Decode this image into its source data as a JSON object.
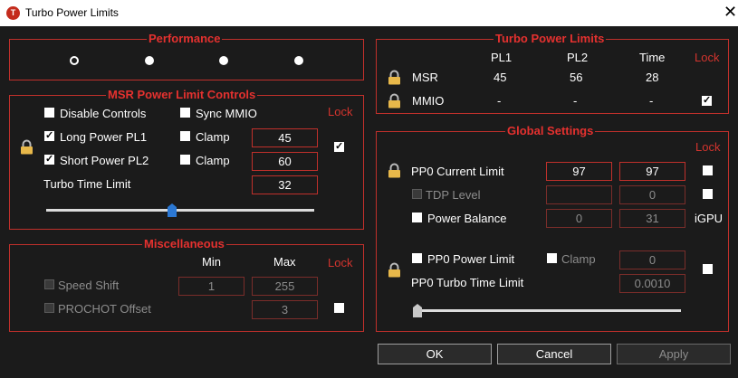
{
  "window": {
    "title": "Turbo Power Limits",
    "app_icon_letter": "T"
  },
  "performance": {
    "title": "Performance",
    "selected_index": 0,
    "options": 4
  },
  "msr": {
    "title": "MSR Power Limit Controls",
    "disable_controls": {
      "label": "Disable Controls",
      "checked": false
    },
    "sync_mmio": {
      "label": "Sync MMIO",
      "checked": false
    },
    "lock_label": "Lock",
    "lock_checked": true,
    "long_power": {
      "label": "Long Power PL1",
      "checked": true,
      "clamp_label": "Clamp",
      "clamp_checked": false,
      "value": "45"
    },
    "short_power": {
      "label": "Short Power PL2",
      "checked": true,
      "clamp_label": "Clamp",
      "clamp_checked": false,
      "value": "60"
    },
    "turbo_time": {
      "label": "Turbo Time Limit",
      "value": "32"
    },
    "slider_fraction": 0.47
  },
  "misc": {
    "title": "Miscellaneous",
    "min_label": "Min",
    "max_label": "Max",
    "lock_label": "Lock",
    "speed_shift": {
      "label": "Speed Shift",
      "min": "1",
      "max": "255"
    },
    "prochot": {
      "label": "PROCHOT Offset",
      "value": "3"
    }
  },
  "turbo_limits": {
    "title": "Turbo Power Limits",
    "headers": {
      "pl1": "PL1",
      "pl2": "PL2",
      "time": "Time",
      "lock": "Lock"
    },
    "msr_row": {
      "label": "MSR",
      "pl1": "45",
      "pl2": "56",
      "time": "28"
    },
    "mmio_row": {
      "label": "MMIO",
      "pl1": "-",
      "pl2": "-",
      "time": "-",
      "lock_checked": true
    }
  },
  "global": {
    "title": "Global Settings",
    "lock_label": "Lock",
    "pp0_current": {
      "label": "PP0 Current Limit",
      "value1": "97",
      "value2": "97"
    },
    "tdp_level": {
      "label": "TDP Level",
      "value1": "",
      "value2": "0"
    },
    "power_balance": {
      "label": "Power Balance",
      "value1": "0",
      "value2": "31",
      "suffix": "iGPU"
    },
    "pp0_power": {
      "label": "PP0 Power Limit",
      "clamp_label": "Clamp",
      "value": "0"
    },
    "pp0_turbo": {
      "label": "PP0 Turbo Time Limit",
      "value": "0.0010"
    },
    "slider_fraction": 0.0
  },
  "buttons": {
    "ok": "OK",
    "cancel": "Cancel",
    "apply": "Apply"
  },
  "colors": {
    "accent_red": "#e5312f",
    "background": "#1b1b1b",
    "lock_gold": "#e8b84a"
  }
}
